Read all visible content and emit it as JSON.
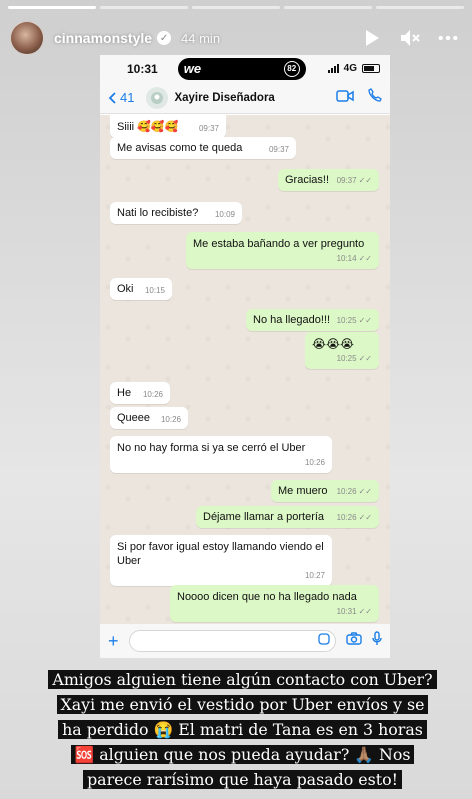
{
  "story": {
    "username": "cinnamonstyle",
    "time_ago": "44 min",
    "icons": [
      "play-icon",
      "mute-icon",
      "more-icon"
    ]
  },
  "phone": {
    "status": {
      "time": "10:31",
      "app_logo": "we",
      "notif_count": "82",
      "network": "4G"
    },
    "chat_header": {
      "back_count": "41",
      "contact_name": "Xayire Diseñadora"
    },
    "messages": [
      {
        "dir": "in",
        "text": "Siiii 🥰🥰🥰",
        "time": "09:37"
      },
      {
        "dir": "in",
        "text": "Me avisas como te queda",
        "time": "09:37"
      },
      {
        "dir": "out",
        "text": "Gracias!!",
        "time": "09:37"
      },
      {
        "dir": "in",
        "text": "Nati lo recibiste?",
        "time": "10:09"
      },
      {
        "dir": "out",
        "text": "Me estaba bañando a ver pregunto",
        "time": "10:14"
      },
      {
        "dir": "in",
        "text": "Oki",
        "time": "10:15"
      },
      {
        "dir": "out",
        "text": "No ha llegado!!!",
        "time": "10:25"
      },
      {
        "dir": "out",
        "text": "😭😭😭",
        "time": "10:25"
      },
      {
        "dir": "in",
        "text": "He",
        "time": "10:26"
      },
      {
        "dir": "in",
        "text": "Queee",
        "time": "10:26"
      },
      {
        "dir": "in",
        "text": "No no hay forma si ya se cerró el Uber",
        "time": "10:26"
      },
      {
        "dir": "out",
        "text": "Me muero",
        "time": "10:26"
      },
      {
        "dir": "out",
        "text": "Déjame llamar a portería",
        "time": "10:26"
      },
      {
        "dir": "in",
        "text": "Si por favor igual estoy llamando viendo el Uber",
        "time": "10:27"
      },
      {
        "dir": "out",
        "text": "Noooo dicen que no ha llegado nada",
        "time": "10:31"
      }
    ]
  },
  "caption": {
    "lines": [
      "Amigos alguien tiene algún contacto con Uber?",
      "Xayi me envió el vestido por Uber envíos y se",
      "ha perdido 😭 El matri de Tana es en 3 horas",
      "🆘 alguien que nos pueda ayudar? 🙏🏽 Nos",
      "parece rarísimo que haya pasado esto!"
    ]
  },
  "colors": {
    "incoming": "#ffffff",
    "outgoing": "#dcf8c6",
    "chat_bg": "#ece5dd",
    "ios_blue": "#1b7ee8"
  }
}
